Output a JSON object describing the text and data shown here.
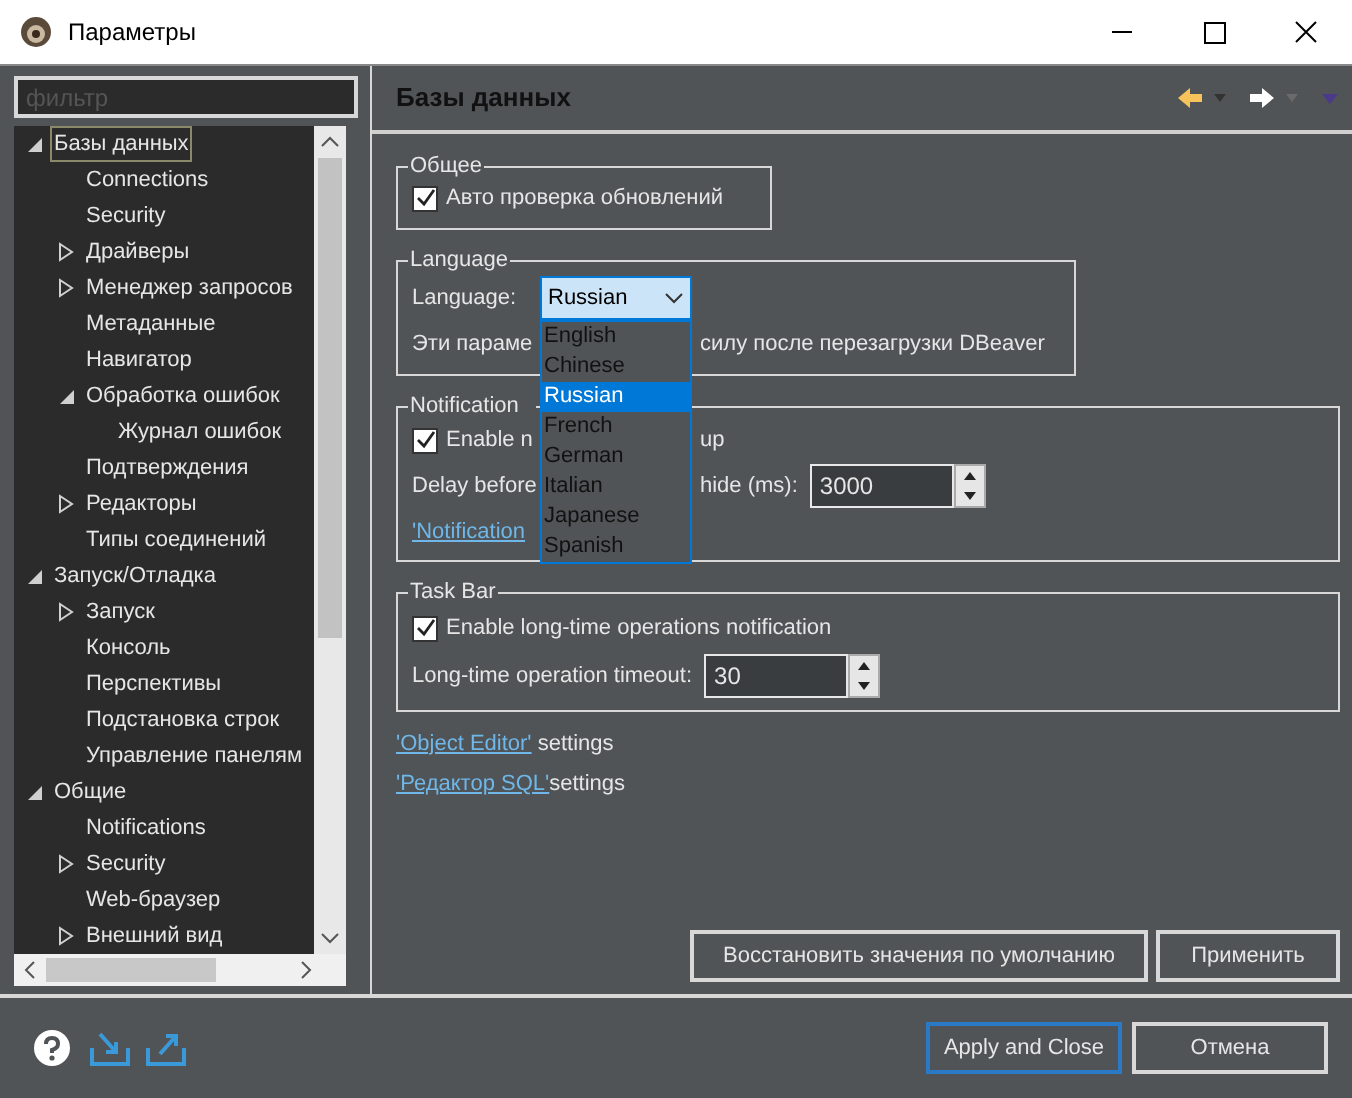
{
  "window": {
    "title": "Параметры"
  },
  "filter": {
    "placeholder": "фильтр"
  },
  "tree": [
    {
      "label": "Базы данных",
      "selected": true,
      "expanded": true,
      "children": [
        {
          "label": "Connections",
          "selected": false
        },
        {
          "label": "Security",
          "selected": false
        },
        {
          "label": "Драйверы",
          "selected": false,
          "expanded": false
        },
        {
          "label": "Менеджер запросов",
          "selected": false,
          "expanded": false
        },
        {
          "label": "Метаданные",
          "selected": false
        },
        {
          "label": "Навигатор",
          "selected": false
        },
        {
          "label": "Обработка ошибок",
          "selected": false,
          "expanded": true,
          "children": [
            {
              "label": "Журнал ошибок",
              "selected": false
            }
          ]
        },
        {
          "label": "Подтверждения",
          "selected": false
        },
        {
          "label": "Редакторы",
          "selected": false,
          "expanded": false
        },
        {
          "label": "Типы соединений",
          "selected": false
        }
      ]
    },
    {
      "label": "Запуск/Отладка",
      "selected": false,
      "expanded": true,
      "children": [
        {
          "label": "Запуск",
          "selected": false,
          "expanded": false
        },
        {
          "label": "Консоль",
          "selected": false
        },
        {
          "label": "Перспективы",
          "selected": false
        },
        {
          "label": "Подстановка строк",
          "selected": false
        },
        {
          "label": "Управление панелям",
          "selected": false
        }
      ]
    },
    {
      "label": "Общие",
      "selected": false,
      "expanded": true,
      "children": [
        {
          "label": "Notifications",
          "selected": false
        },
        {
          "label": "Security",
          "selected": false,
          "expanded": false
        },
        {
          "label": "Web-браузер",
          "selected": false
        },
        {
          "label": "Внешний вид",
          "selected": false,
          "expanded": false
        }
      ]
    }
  ],
  "page": {
    "title": "Базы данных"
  },
  "general": {
    "legend": "Общее",
    "auto_update": {
      "label": "Авто проверка обновлений",
      "checked": true
    }
  },
  "language": {
    "legend": "Language",
    "label": "Language:",
    "value": "Russian",
    "note_before": "Эти параме",
    "note_after": "силу после перезагрузки DBeaver",
    "options": [
      {
        "label": "English",
        "selected": false
      },
      {
        "label": "Chinese",
        "selected": false
      },
      {
        "label": "Russian",
        "selected": true
      },
      {
        "label": "French",
        "selected": false
      },
      {
        "label": "German",
        "selected": false
      },
      {
        "label": "Italian",
        "selected": false
      },
      {
        "label": "Japanese",
        "selected": false
      },
      {
        "label": "Spanish",
        "selected": false
      }
    ]
  },
  "notifications": {
    "legend": "Notification",
    "enable": {
      "label_before": "Enable n",
      "label_after": "up",
      "checked": true
    },
    "delay": {
      "label_before": "Delay before",
      "label_after": "hide (ms):",
      "value": "3000"
    },
    "link": "'Notification"
  },
  "task_bar": {
    "legend": "Task Bar",
    "enable": {
      "label": "Enable long-time operations notification",
      "checked": true
    },
    "timeout": {
      "label": "Long-time operation timeout:",
      "value": "30"
    }
  },
  "links": [
    {
      "link": "'Object Editor'",
      "text": " settings"
    },
    {
      "link": "'Редактор SQL'",
      "text": "settings"
    }
  ],
  "page_buttons": [
    {
      "label": "Восстановить значения по умолчанию",
      "primary": false
    },
    {
      "label": "Применить",
      "primary": false
    }
  ],
  "dialog_buttons": [
    {
      "label": "Apply and Close",
      "primary": true
    },
    {
      "label": "Отмена",
      "primary": false
    }
  ]
}
